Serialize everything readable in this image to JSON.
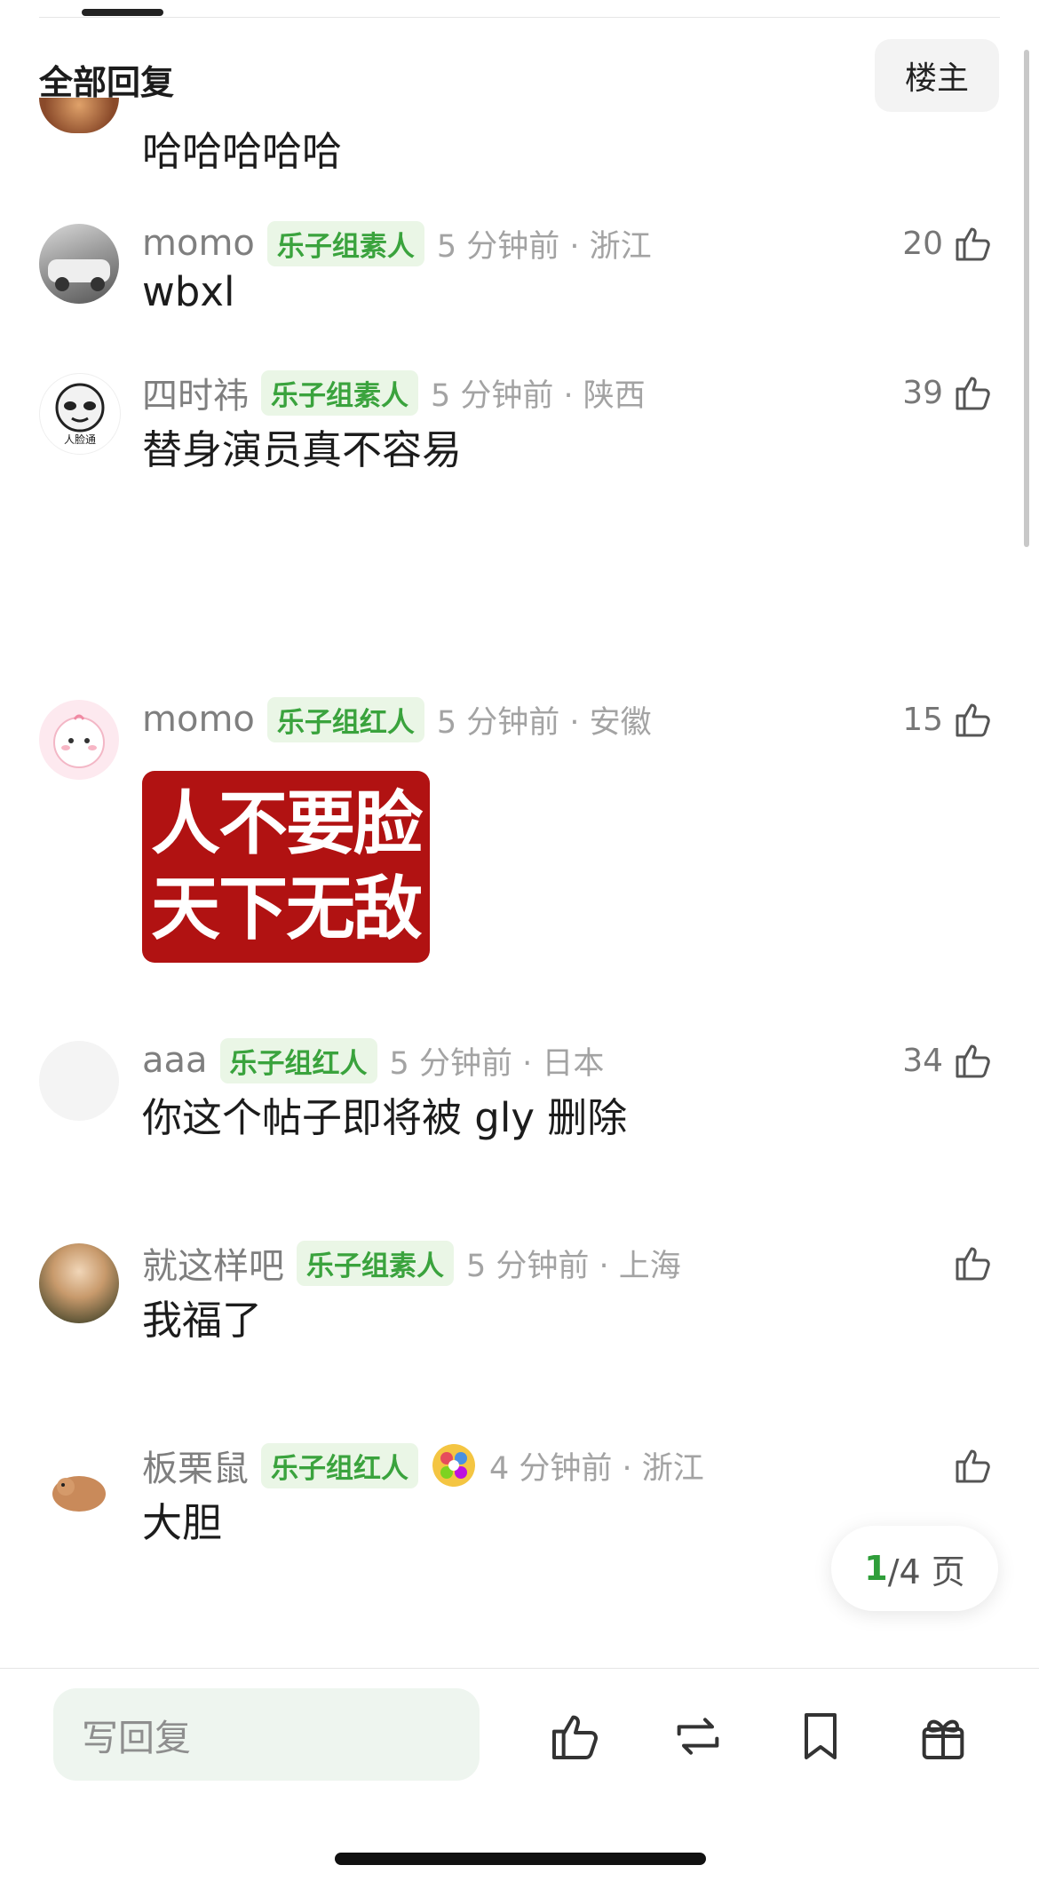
{
  "header": {
    "title": "全部回复",
    "op_label": "楼主"
  },
  "comments": [
    {
      "username": "",
      "badge": "",
      "time": "",
      "likes": "",
      "text": "哈哈哈哈哈"
    },
    {
      "username": "momo",
      "badge": "乐子组素人",
      "time": "5 分钟前 · 浙江",
      "likes": "20",
      "text": "wbxl"
    },
    {
      "username": "四时祎",
      "badge": "乐子组素人",
      "time": "5 分钟前 · 陕西",
      "likes": "39",
      "text": "替身演员真不容易"
    },
    {
      "username": "momo",
      "badge": "乐子组红人",
      "time": "5 分钟前 · 安徽",
      "likes": "15",
      "sticker_line1": "人不要脸",
      "sticker_line2": "天下无敌"
    },
    {
      "username": "aaa",
      "badge": "乐子组红人",
      "time": "5 分钟前 · 日本",
      "likes": "34",
      "text": "你这个帖子即将被 gly 删除"
    },
    {
      "username": "就这样吧",
      "badge": "乐子组素人",
      "time": "5 分钟前 · 上海",
      "likes": "",
      "text": "我福了"
    },
    {
      "username": "板栗鼠",
      "badge": "乐子组红人",
      "time": "4 分钟前 · 浙江",
      "likes": "",
      "text": "大胆"
    }
  ],
  "pagination": {
    "current": "1",
    "rest": "/4 页"
  },
  "bottom_bar": {
    "reply_placeholder": "写回复"
  },
  "colors": {
    "accent_green": "#3aa33d",
    "badge_bg": "#eaf6e6",
    "sticker_red": "#b11212"
  },
  "icons": [
    "thumb-up-icon",
    "repost-icon",
    "bookmark-icon",
    "gift-icon"
  ]
}
